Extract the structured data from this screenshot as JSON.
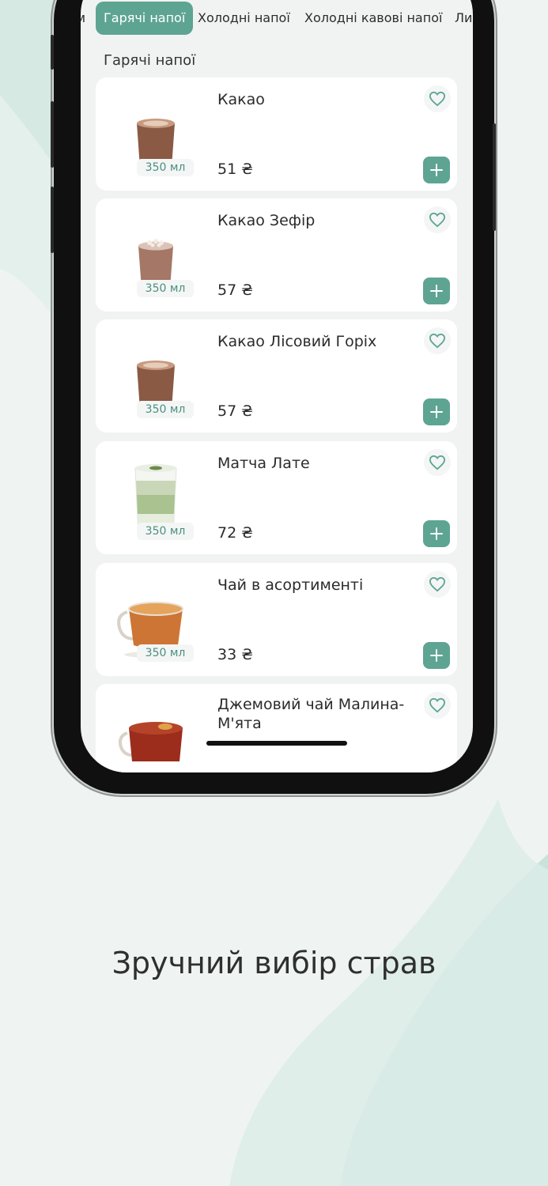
{
  "tabs": [
    {
      "label": "м",
      "active": false
    },
    {
      "label": "Гарячі напої",
      "active": true
    },
    {
      "label": "Холодні напої",
      "active": false
    },
    {
      "label": "Холодні кавові напої",
      "active": false
    },
    {
      "label": "Ли",
      "active": false
    }
  ],
  "section_title": "Гарячі напої",
  "products": [
    {
      "name": "Какао",
      "price": "51 ₴",
      "volume": "350 мл",
      "image": "cocoa-cup-icon"
    },
    {
      "name": "Какао Зефір",
      "price": "57 ₴",
      "volume": "350 мл",
      "image": "cocoa-marshmallow-cup-icon"
    },
    {
      "name": "Какао Лісовий Горіх",
      "price": "57 ₴",
      "volume": "350 мл",
      "image": "cocoa-cup-icon"
    },
    {
      "name": "Матча Лате",
      "price": "72 ₴",
      "volume": "350 мл",
      "image": "matcha-latte-glass-icon"
    },
    {
      "name": "Чай в асортименті",
      "price": "33 ₴",
      "volume": "350 мл",
      "image": "tea-cup-icon"
    },
    {
      "name": "Джемовий чай Малина-М'ята",
      "price": "",
      "volume": "",
      "image": "jam-tea-cup-icon"
    }
  ],
  "icons": {
    "favorite": "heart-icon",
    "add": "plus-icon"
  },
  "headline": "Зручний вибір страв",
  "colors": {
    "accent": "#5ea493",
    "background": "#eff4f2",
    "wave": "#d4e9e3"
  }
}
